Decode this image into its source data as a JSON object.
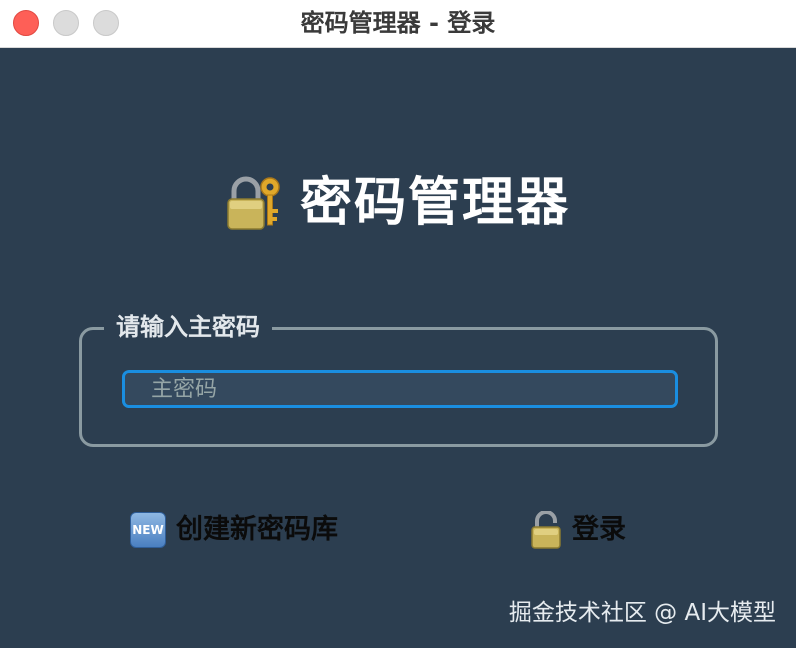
{
  "window": {
    "title": "密码管理器 - 登录",
    "traffic_lights": {
      "close": "#fe5f57",
      "minimize": "#dcdcdc",
      "zoom": "#dcdcdc"
    }
  },
  "header": {
    "icon": "lock-with-key-icon",
    "title": "密码管理器"
  },
  "password_group": {
    "legend": "请输入主密码",
    "input_value": "",
    "input_placeholder": "主密码"
  },
  "actions": {
    "create": {
      "icon": "new-icon",
      "icon_text": "NEW",
      "label": "创建新密码库"
    },
    "login": {
      "icon": "open-lock-icon",
      "label": "登录"
    }
  },
  "watermark": "掘金技术社区 @ AI大模型",
  "colors": {
    "background": "#2c3e50",
    "focus_ring": "#1a8ee0",
    "group_border": "#8a9aa1",
    "title_text": "#ffffff"
  }
}
